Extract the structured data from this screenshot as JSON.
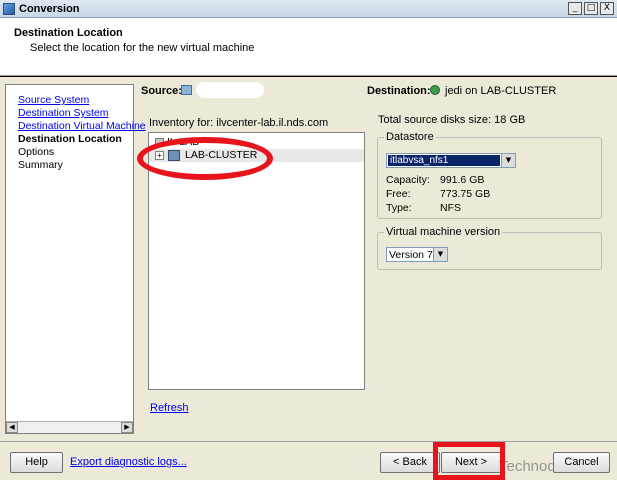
{
  "window": {
    "title": "Conversion",
    "buttons": {
      "minimize": "_",
      "maximize": "□",
      "close": "X"
    }
  },
  "header": {
    "title": "Destination Location",
    "subtitle": "Select the location for the new virtual machine"
  },
  "steps": [
    {
      "label": "Source System",
      "state": "link"
    },
    {
      "label": "Destination System",
      "state": "link"
    },
    {
      "label": "Destination Virtual Machine",
      "state": "link"
    },
    {
      "label": "Destination Location",
      "state": "current"
    },
    {
      "label": "Options",
      "state": "pending"
    },
    {
      "label": "Summary",
      "state": "pending"
    }
  ],
  "source": {
    "label": "Source:"
  },
  "destination": {
    "label": "Destination:",
    "value": "jedi on LAB-CLUSTER"
  },
  "inventory": {
    "label": "Inventory for: ilvcenter-lab.il.nds.com",
    "tree": [
      {
        "label": "IL-LAB",
        "icon": "datacenter-icon"
      },
      {
        "label": "LAB-CLUSTER",
        "icon": "cluster-icon",
        "expander": "+"
      }
    ],
    "refresh_label": "Refresh"
  },
  "disk_size": "Total source disks size:  18 GB",
  "datastore": {
    "legend": "Datastore",
    "selected": "itlabvsa_nfs1",
    "capacity_label": "Capacity:",
    "capacity_value": "991.6 GB",
    "free_label": "Free:",
    "free_value": "773.75 GB",
    "type_label": "Type:",
    "type_value": "NFS"
  },
  "vm_version": {
    "legend": "Virtual machine version",
    "selected": "Version 7"
  },
  "footer": {
    "help": "Help",
    "export": "Export diagnostic logs...",
    "back": "< Back",
    "next": "Next >",
    "cancel": "Cancel",
    "watermark": "Technodrone"
  },
  "colors": {
    "annotation": "#e8141c",
    "link": "#0000ee",
    "selection": "#0a246a"
  }
}
